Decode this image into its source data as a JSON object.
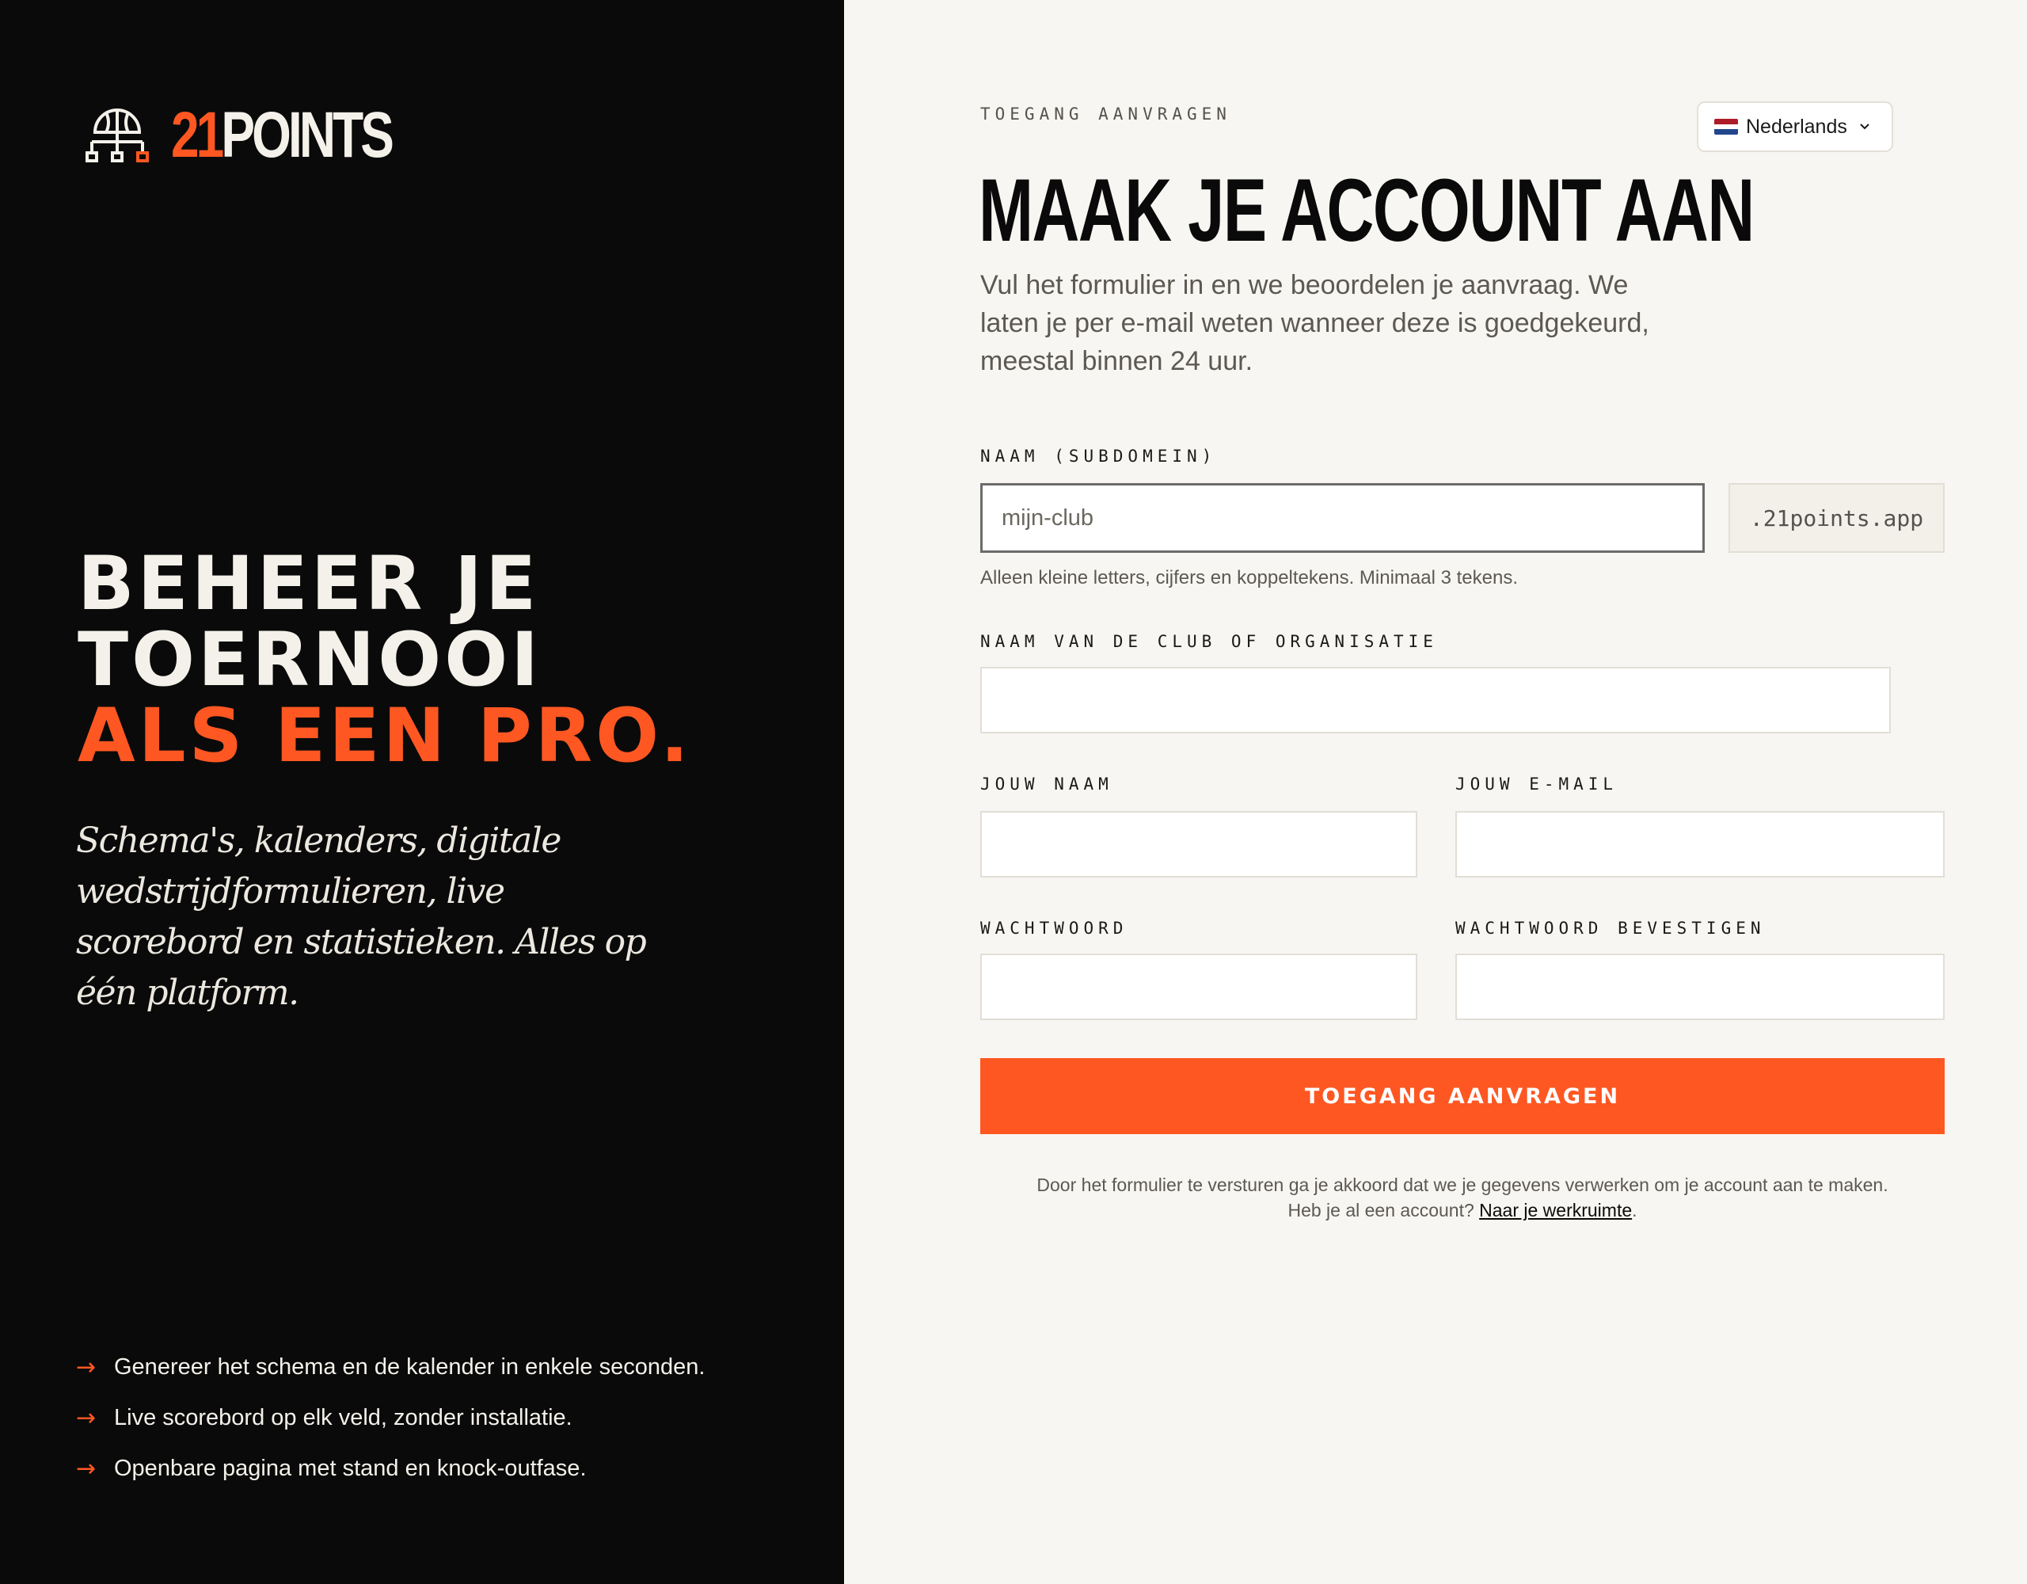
{
  "brand": {
    "logo_icon": "basketball-bracket-icon",
    "num": "21",
    "word": "POINTS",
    "accent": "#ff5722"
  },
  "hero": {
    "line1": "BEHEER JE",
    "line2": "TOERNOOI",
    "line3": "ALS EEN PRO.",
    "lede": "Schema's, kalenders, digitale wedstrijdformulieren, live scorebord en statistieken. Alles op één platform."
  },
  "features": [
    {
      "icon": "arrow-right-icon",
      "text": "Genereer het schema en de kalender in enkele seconden."
    },
    {
      "icon": "arrow-right-icon",
      "text": "Live scorebord op elk veld, zonder installatie."
    },
    {
      "icon": "arrow-right-icon",
      "text": "Openbare pagina met stand en knock-outfase."
    }
  ],
  "language": {
    "selected": "Nederlands",
    "flag": "netherlands-flag-icon"
  },
  "form": {
    "eyebrow": "TOEGANG AANVRAGEN",
    "title": "MAAK JE ACCOUNT AAN",
    "intro": "Vul het formulier in en we beoordelen je aanvraag. We laten je per e-mail weten wanneer deze is goedgekeurd, meestal binnen 24 uur.",
    "subdomain": {
      "label": "NAAM (SUBDOMEIN)",
      "placeholder": "mijn-club",
      "suffix": ".21points.app",
      "hint": "Alleen kleine letters, cijfers en koppeltekens. Minimaal 3 tekens."
    },
    "club": {
      "label": "NAAM VAN DE CLUB OF ORGANISATIE",
      "value": ""
    },
    "name": {
      "label": "JOUW NAAM",
      "value": ""
    },
    "email": {
      "label": "JOUW E-MAIL",
      "value": ""
    },
    "password": {
      "label": "WACHTWOORD",
      "value": ""
    },
    "password_confirm": {
      "label": "WACHTWOORD BEVESTIGEN",
      "value": ""
    },
    "submit_label": "TOEGANG AANVRAGEN",
    "legal_text": "Door het formulier te versturen ga je akkoord dat we je gegevens verwerken om je account aan te maken.",
    "login_prompt": "Heb je al een account?",
    "login_link": "Naar je werkruimte",
    "login_suffix": "."
  }
}
